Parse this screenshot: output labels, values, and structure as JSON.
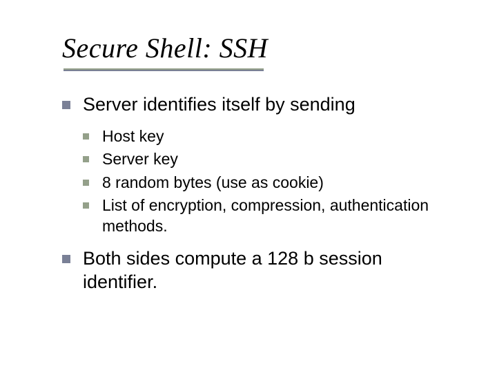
{
  "slide": {
    "title": "Secure Shell: SSH",
    "points": [
      {
        "text": "Server identifies itself by sending",
        "sub": [
          "Host key",
          "Server key",
          "8 random bytes (use as cookie)",
          "List of encryption, compression, authentication methods."
        ]
      },
      {
        "text": "Both sides compute a 128 b session identifier."
      }
    ]
  }
}
